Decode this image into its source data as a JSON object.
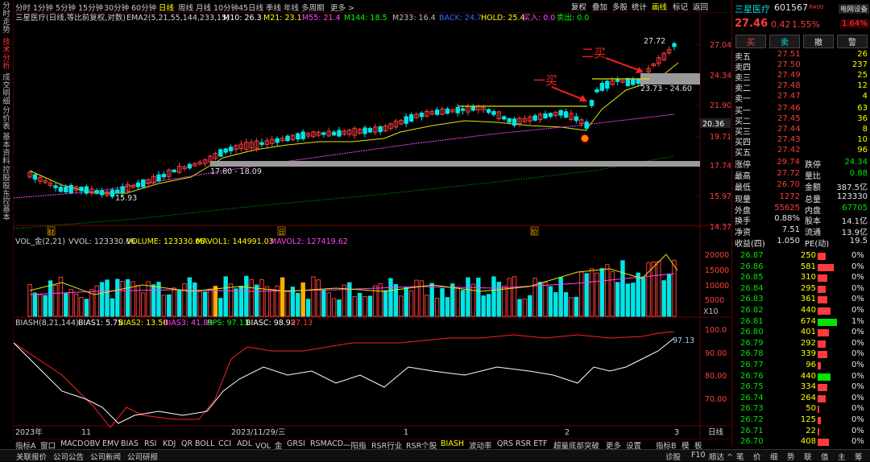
{
  "left_tabs": [
    {
      "label": "分时走势",
      "active": false
    },
    {
      "label": "技术分析",
      "active": true
    },
    {
      "label": "成交明细",
      "active": false
    },
    {
      "label": "分价表",
      "active": false
    },
    {
      "label": "基本资料",
      "active": false
    },
    {
      "label": "控股股东",
      "active": false
    },
    {
      "label": "控基本",
      "active": false
    }
  ],
  "periods": [
    "分时",
    "1分钟",
    "5分钟",
    "15分钟",
    "30分钟",
    "60分钟",
    "日线",
    "周线",
    "月线",
    "10分钟",
    "45日线",
    "季线",
    "年线",
    "多周期",
    "更多 >"
  ],
  "period_selected": "日线",
  "toolbar": [
    "复权",
    "叠加",
    "多股",
    "统计",
    "画线",
    "标记",
    "返回"
  ],
  "toolbar_selected": "画线",
  "main_legend": {
    "title": "三星医疗(日线,等比前复权,对数)",
    "ema": "EMA2(5,21,55,144,233,15)",
    "m10": "M10: 26.3",
    "m21": "M21: 23.1",
    "m55": "M55: 21.4",
    "m144": "M144: 18.5",
    "m233": "M233: 16.4",
    "back": "BACK: 24.7",
    "hold": "HOLD: 25.4",
    "buy": "买入: 0.0",
    "sell": "卖出: 0.0"
  },
  "price_axis": [
    "27.04",
    "24.34",
    "21.90",
    "19.71",
    "17.74",
    "15.97",
    "14.37"
  ],
  "price_tag": "20.36",
  "annotations": {
    "high": "27.72",
    "low": "15.93",
    "range1": "17.80 - 18.09",
    "range2": "23.73 - 24.60",
    "buy1": "一买",
    "buy2": "二买",
    "event_marks": [
      "财",
      "日",
      "阶"
    ]
  },
  "vol_legend": {
    "title": "VOL_金(2,21)",
    "vvol": "VVOL: 123330.06",
    "volume": "VOLUME: 123330.06",
    "mavol1": "MAVOL1: 144991.03",
    "mavol2": "MAVOL2: 127419.62"
  },
  "vol_axis": [
    "20000",
    "15000",
    "10000",
    "5000"
  ],
  "vol_unit": "X10",
  "bias_legend": {
    "title": "BIASH(8,21,144)",
    "b1": "BIAS1: 5.75",
    "b2": "BIAS2: 13.50",
    "b3": "BIAS3: 41.89",
    "rps": "RPS: 97.13",
    "biasc": "BIASC: 98.92",
    "extra": "97.13"
  },
  "bias_axis": [
    "100.0",
    "90.00",
    "80.00",
    "70.00"
  ],
  "bias_tag": "97.13",
  "time_axis": {
    "labels": [
      "2023年",
      "11",
      "2023/11/29/三",
      "1",
      "2",
      "3"
    ],
    "right": "日线"
  },
  "bottom_tabs": [
    "指标A",
    "窗口",
    "MACD",
    "OBV",
    "EMV",
    "BIAS",
    "RSI",
    "KDJ",
    "QR",
    "BOLL",
    "CCI",
    "ADL",
    "VOL_金",
    "GRSI",
    "RSMACD",
    "一阳指",
    "RSR行业",
    "RSR个股",
    "BIASH",
    "波动率",
    "QRS",
    "RSR ETF",
    "超量底部突破",
    "更多",
    "设置"
  ],
  "bottom_tab_selected": "BIASH",
  "bottom_right": [
    "指标B",
    "模",
    "板"
  ],
  "status_left": [
    "关联报价",
    "公司公告",
    "公司新闻",
    "公司研报"
  ],
  "status_right": [
    "诊股",
    "F10",
    "顺达 ^"
  ],
  "status_right_icons": [
    "笔",
    "价",
    "细",
    "势",
    "联",
    "值",
    "主",
    "筹"
  ],
  "quote": {
    "name": "三星医疗",
    "code": "601567",
    "tag": "R¥00",
    "network": "电网设备",
    "price": "27.46",
    "change": "0.42",
    "pct": "1.55%",
    "sector_pct": "1.64%",
    "actions": [
      "买",
      "卖",
      "撤",
      "警"
    ]
  },
  "order_book": {
    "asks": [
      {
        "label": "卖五",
        "price": "27.51",
        "vol": "26"
      },
      {
        "label": "卖四",
        "price": "27.50",
        "vol": "237"
      },
      {
        "label": "卖三",
        "price": "27.49",
        "vol": "25"
      },
      {
        "label": "卖二",
        "price": "27.48",
        "vol": "12"
      },
      {
        "label": "卖一",
        "price": "27.47",
        "vol": "4"
      }
    ],
    "bids": [
      {
        "label": "买一",
        "price": "27.46",
        "vol": "63"
      },
      {
        "label": "买二",
        "price": "27.45",
        "vol": "36"
      },
      {
        "label": "买三",
        "price": "27.44",
        "vol": "8"
      },
      {
        "label": "买四",
        "price": "27.43",
        "vol": "10"
      },
      {
        "label": "买五",
        "price": "27.42",
        "vol": "96"
      }
    ]
  },
  "stats": [
    {
      "l1": "涨停",
      "v1": "29.74",
      "c1": "red",
      "l2": "跌停",
      "v2": "24.34",
      "c2": "green"
    },
    {
      "l1": "最高",
      "v1": "27.72",
      "c1": "red",
      "l2": "量比",
      "v2": "0.88",
      "c2": "green"
    },
    {
      "l1": "最低",
      "v1": "26.70",
      "c1": "red",
      "l2": "金额",
      "v2": "387.5亿",
      "c2": "white"
    },
    {
      "l1": "现量",
      "v1": "1272",
      "c1": "red",
      "l2": "总量",
      "v2": "123330",
      "c2": "white"
    },
    {
      "l1": "外盘",
      "v1": "55625",
      "c1": "red",
      "l2": "内盘",
      "v2": "67705",
      "c2": "green"
    },
    {
      "l1": "换手",
      "v1": "0.88%",
      "c1": "white",
      "l2": "股本",
      "v2": "14.1亿",
      "c2": "white"
    },
    {
      "l1": "净资",
      "v1": "7.51",
      "c1": "white",
      "l2": "流通",
      "v2": "13.9亿",
      "c2": "white"
    },
    {
      "l1": "收益(四)",
      "v1": "1.050",
      "c1": "white",
      "l2": "PE(动)",
      "v2": "19.5",
      "c2": "white"
    }
  ],
  "price_levels": [
    {
      "price": "26.87",
      "vol": "250",
      "pct": "0%",
      "bar": 0.05,
      "c": "red"
    },
    {
      "price": "26.86",
      "vol": "581",
      "pct": "0%",
      "bar": 0.1,
      "c": "red"
    },
    {
      "price": "26.85",
      "vol": "310",
      "pct": "0%",
      "bar": 0.06,
      "c": "red"
    },
    {
      "price": "26.84",
      "vol": "295",
      "pct": "0%",
      "bar": 0.05,
      "c": "red"
    },
    {
      "price": "26.83",
      "vol": "361",
      "pct": "0%",
      "bar": 0.06,
      "c": "red"
    },
    {
      "price": "26.82",
      "vol": "440",
      "pct": "0%",
      "bar": 0.08,
      "c": "red"
    },
    {
      "price": "26.81",
      "vol": "674",
      "pct": "1%",
      "bar": 0.12,
      "c": "green"
    },
    {
      "price": "26.80",
      "vol": "401",
      "pct": "0%",
      "bar": 0.07,
      "c": "red"
    },
    {
      "price": "26.79",
      "vol": "292",
      "pct": "0%",
      "bar": 0.05,
      "c": "red"
    },
    {
      "price": "26.78",
      "vol": "339",
      "pct": "0%",
      "bar": 0.06,
      "c": "red"
    },
    {
      "price": "26.77",
      "vol": "96",
      "pct": "0%",
      "bar": 0.02,
      "c": "red"
    },
    {
      "price": "26.76",
      "vol": "440",
      "pct": "0%",
      "bar": 0.08,
      "c": "green"
    },
    {
      "price": "26.75",
      "vol": "334",
      "pct": "0%",
      "bar": 0.06,
      "c": "red"
    },
    {
      "price": "26.74",
      "vol": "264",
      "pct": "0%",
      "bar": 0.05,
      "c": "red"
    },
    {
      "price": "26.73",
      "vol": "50",
      "pct": "0%",
      "bar": 0.01,
      "c": "red"
    },
    {
      "price": "26.72",
      "vol": "125",
      "pct": "0%",
      "bar": 0.02,
      "c": "red"
    },
    {
      "price": "26.71",
      "vol": "22",
      "pct": "0%",
      "bar": 0.005,
      "c": "red"
    },
    {
      "price": "26.70",
      "vol": "408",
      "pct": "0%",
      "bar": 0.07,
      "c": "red"
    }
  ]
}
